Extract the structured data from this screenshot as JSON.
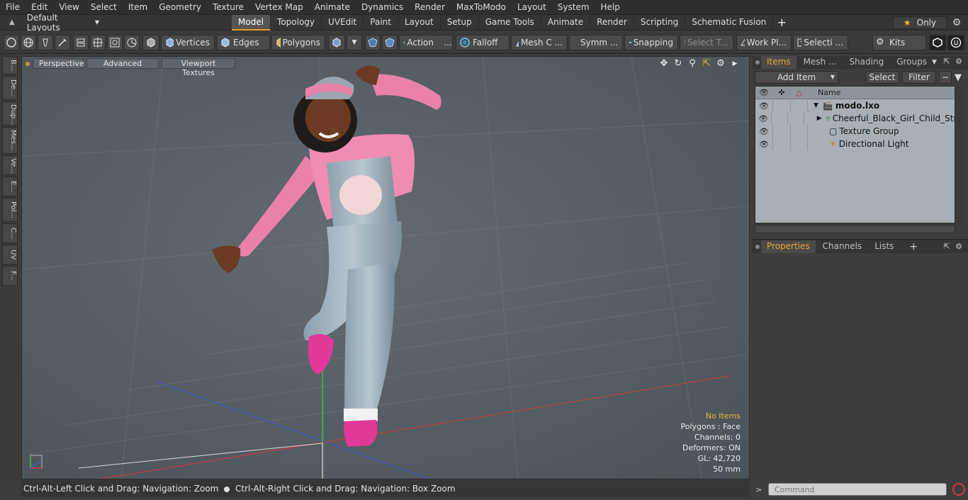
{
  "menu": [
    "File",
    "Edit",
    "View",
    "Select",
    "Item",
    "Geometry",
    "Texture",
    "Vertex Map",
    "Animate",
    "Dynamics",
    "Render",
    "MaxToModo",
    "Layout",
    "System",
    "Help"
  ],
  "layout": {
    "label": "Default Layouts"
  },
  "tabs": [
    "Model",
    "Topology",
    "UVEdit",
    "Paint",
    "Layout",
    "Setup",
    "Game Tools",
    "Animate",
    "Render",
    "Scripting",
    "Schematic Fusion"
  ],
  "active_tab": "Model",
  "only_label": "Only",
  "toolbar": {
    "vertices": "Vertices",
    "edges": "Edges",
    "polygons": "Polygons",
    "action": "Action",
    "falloff": "Falloff",
    "mesh": "Mesh C ...",
    "symm": "Symm ...",
    "snapping": "Snapping",
    "select_t": "Select T...",
    "work_pl": "Work Pl...",
    "selecti": "Selecti ...",
    "kits": "Kits"
  },
  "vstrip": [
    "B...",
    "De...",
    "Dup...",
    "Mes...",
    "Ve...",
    "E...",
    "Pol...",
    "C...",
    "UV",
    "F..."
  ],
  "viewport": {
    "perspective": "Perspective",
    "advanced": "Advanced",
    "textures": "Viewport Textures",
    "info": {
      "no_items": "No Items",
      "polygons": "Polygons : Face",
      "channels": "Channels: 0",
      "deformers": "Deformers: ON",
      "gl": "GL: 42,720",
      "scale": "50 mm"
    }
  },
  "status": {
    "left": "Ctrl-Alt-Left Click and Drag: Navigation: Zoom",
    "right": "Ctrl-Alt-Right Click and Drag: Navigation: Box Zoom"
  },
  "right_panel": {
    "tabs": [
      "Items",
      "Mesh ...",
      "Shading",
      "Groups"
    ],
    "add_item": "Add Item",
    "select": "Select",
    "filter": "Filter",
    "name_col": "Name",
    "tree": [
      {
        "label": "modo.lxo"
      },
      {
        "label": "Cheerful_Black_Girl_Child_Str..."
      },
      {
        "label": "Texture Group"
      },
      {
        "label": "Directional Light"
      }
    ],
    "ptabs": [
      "Properties",
      "Channels",
      "Lists"
    ]
  },
  "command": {
    "placeholder": "Command"
  },
  "colors": {
    "accent": "#e09a2b",
    "viewport_bg": "#535b61",
    "info_yellow": "#e7b53c"
  }
}
